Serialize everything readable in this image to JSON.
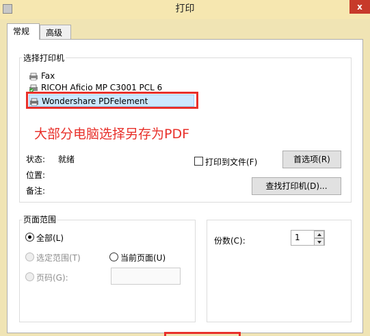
{
  "window": {
    "title": "打印",
    "close": "x"
  },
  "tabs": [
    {
      "label": "常规"
    },
    {
      "label": "高级"
    }
  ],
  "select_printer": {
    "legend": "选择打印机",
    "printers": [
      {
        "name": "Fax"
      },
      {
        "name": "RICOH Aficio MP C3001 PCL 6"
      },
      {
        "name": "Wondershare PDFelement"
      }
    ]
  },
  "annotation": "大部分电脑选择另存为PDF",
  "status": {
    "status_label": "状态:",
    "status_value": "就绪",
    "location_label": "位置:",
    "comment_label": "备注:"
  },
  "print_to_file": "打印到文件(F)",
  "preferences_button": "首选项(R)",
  "find_printer_button": "查找打印机(D)...",
  "page_range": {
    "legend": "页面范围",
    "all": "全部(L)",
    "selection": "选定范围(T)",
    "current": "当前页面(U)",
    "pages": "页码(G):"
  },
  "copies": {
    "label": "份数(C):",
    "value": "1"
  },
  "colors": {
    "accent_red": "#e8302a",
    "selection": "#cce8ff"
  }
}
